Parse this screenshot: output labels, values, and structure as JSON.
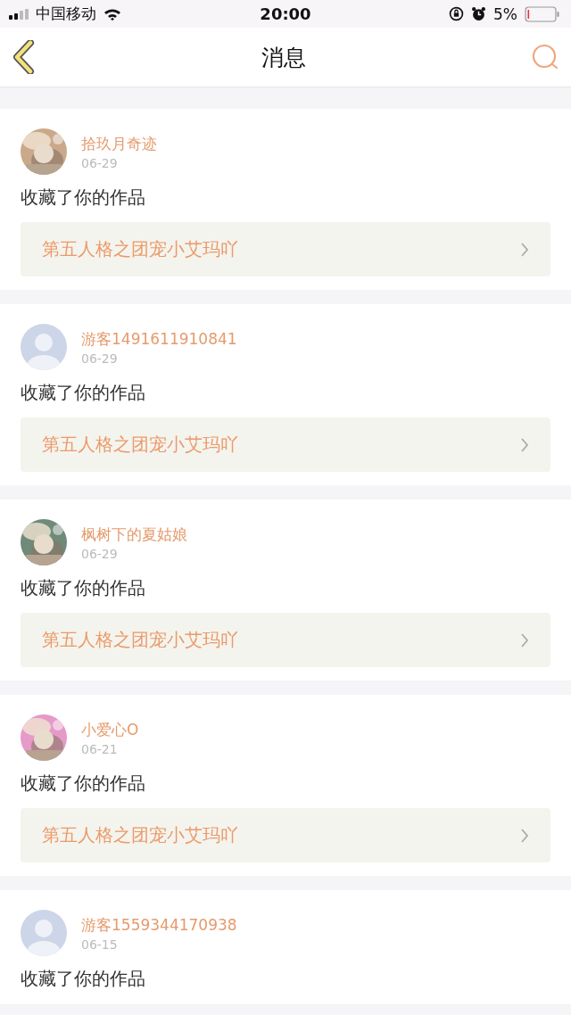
{
  "status_bar": {
    "carrier": "中国移动",
    "time": "20:00",
    "battery": "5%"
  },
  "nav": {
    "title": "消息"
  },
  "messages": [
    {
      "user": "拾玖月奇迹",
      "date": "06-29",
      "action": "收藏了你的作品",
      "work": "第五人格之团宠小艾玛吖"
    },
    {
      "user": "游客1491611910841",
      "date": "06-29",
      "avatar": {
        "kind": "default"
      },
      "action": "收藏了你的作品",
      "work": "第五人格之团宠小艾玛吖"
    },
    {
      "user": "枫树下的夏姑娘",
      "date": "06-29",
      "action": "收藏了你的作品",
      "work": "第五人格之团宠小艾玛吖"
    },
    {
      "user": "小爱心O",
      "date": "06-21",
      "action": "收藏了你的作品",
      "work": "第五人格之团宠小艾玛吖"
    },
    {
      "user": "游客1559344170938",
      "date": "06-15",
      "avatar": {
        "kind": "default"
      },
      "action": "收藏了你的作品"
    }
  ]
}
